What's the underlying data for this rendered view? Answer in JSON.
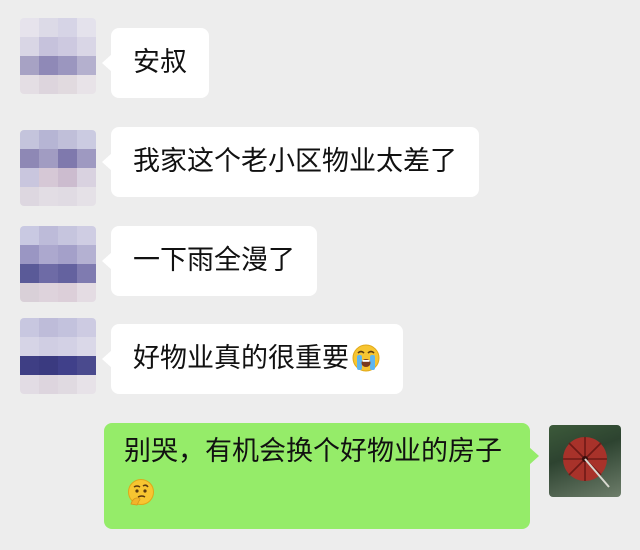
{
  "messages": [
    {
      "side": "left",
      "text": "安叔"
    },
    {
      "side": "left",
      "text": "我家这个老小区物业太差了"
    },
    {
      "side": "left",
      "text": "一下雨全漫了"
    },
    {
      "side": "left",
      "text": "好物业真的很重要",
      "emoji": "loudly-crying-face-icon"
    },
    {
      "side": "right",
      "text": "别哭，有机会换个好物业的房子",
      "emoji": "thinking-face-icon"
    }
  ],
  "avatars": {
    "others": "pixelated-avatar",
    "self": "umbrella-avatar"
  },
  "colors": {
    "background": "#ededed",
    "incoming_bubble": "#ffffff",
    "outgoing_bubble": "#95ec69",
    "text": "#111111"
  }
}
